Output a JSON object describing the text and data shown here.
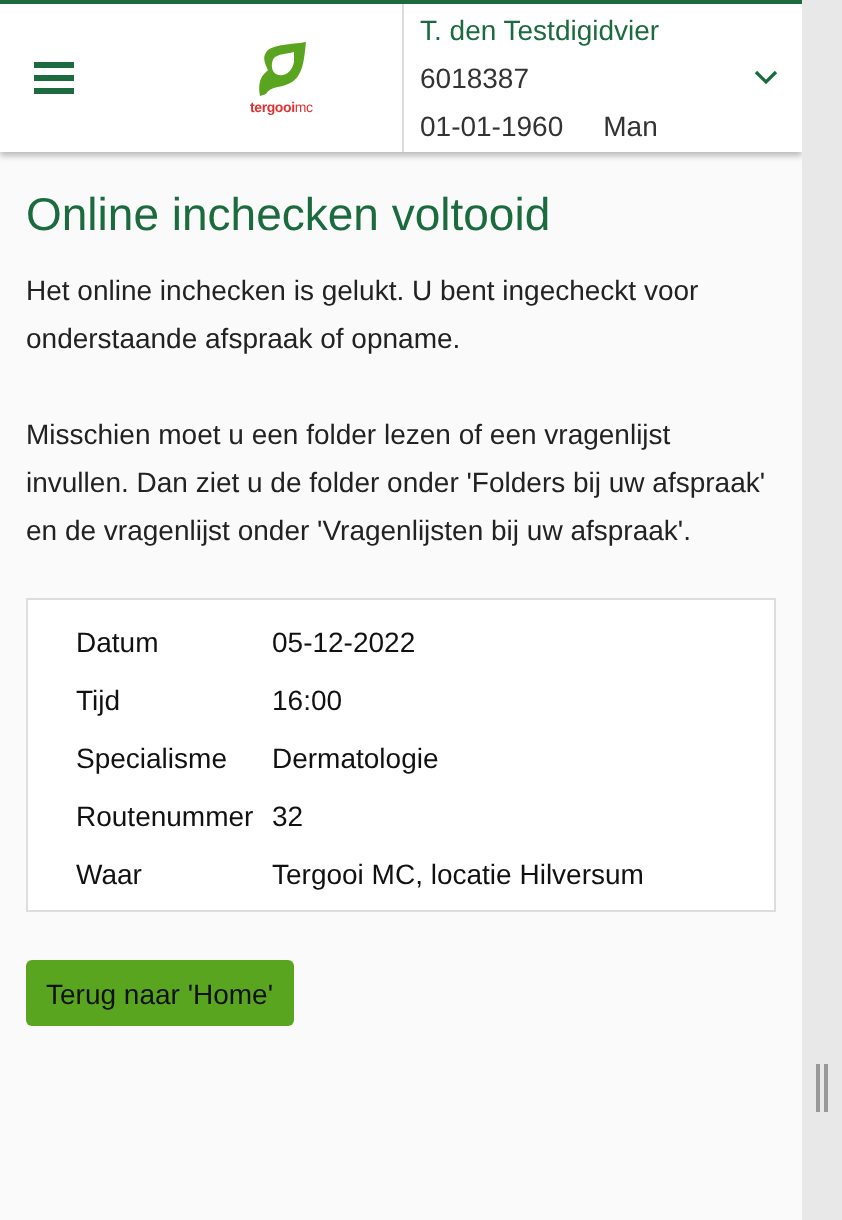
{
  "header": {
    "logo_text": "**tergooi**mc",
    "patient": {
      "name": "T. den Testdigidvier",
      "number": "6018387",
      "birthdate": "01-01-1960",
      "gender": "Man"
    },
    "expanded": false
  },
  "title": "Online inchecken voltooid",
  "paragraphs": [
    "Het online inchecken is gelukt. U bent ingecheckt voor onderstaande afspraak of opname.",
    "Misschien moet u een folder lezen of een vragenlijst invullen. Dan ziet u de folder onder 'Folders bij uw afspraak' en de vragenlijst onder 'Vragenlijsten bij uw afspraak'."
  ],
  "details": [
    {
      "label": "Datum",
      "value": "05-12-2022"
    },
    {
      "label": "Tijd",
      "value": "16:00"
    },
    {
      "label": "Specialisme",
      "value": "Dermatologie"
    },
    {
      "label": "Routenummer",
      "value": "32"
    },
    {
      "label": "Waar",
      "value": "Tergooi MC, locatie Hilversum"
    }
  ],
  "button": "Terug naar 'Home'"
}
